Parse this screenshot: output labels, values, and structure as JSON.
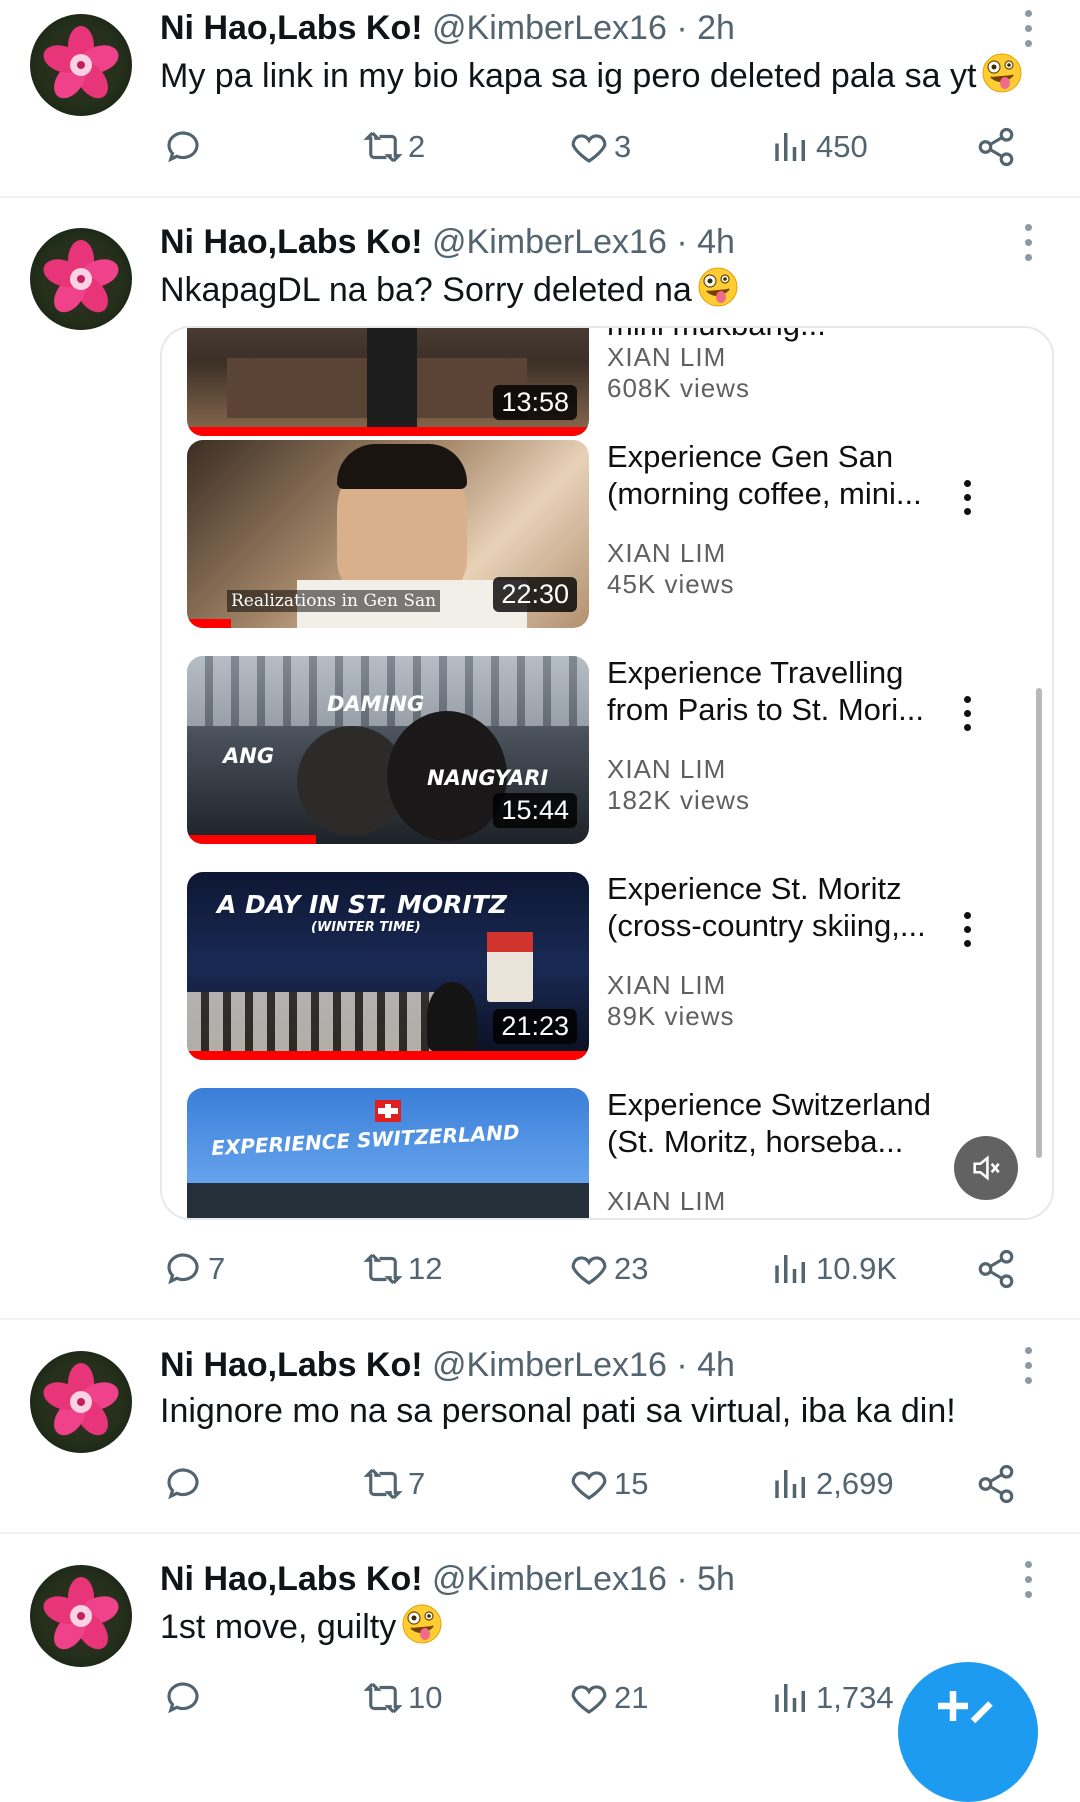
{
  "author": {
    "name": "Ni Hao,Labs Ko!",
    "handle": "@KimberLex16",
    "separator": "·"
  },
  "tweets": [
    {
      "time": "2h",
      "text": "My pa link in my bio kapa sa ig pero deleted pala sa yt",
      "emoji": "zany-face",
      "replies": "",
      "retweets": "2",
      "likes": "3",
      "views": "450"
    },
    {
      "time": "4h",
      "text": "NkapagDL na ba? Sorry deleted na",
      "emoji": "zany-face",
      "replies": "7",
      "retweets": "12",
      "likes": "23",
      "views": "10.9K",
      "media": {
        "videos": [
          {
            "title": "mini mukbang...",
            "channel": "XIAN LIM",
            "views": "608K views",
            "duration": "13:58",
            "progress": 1.0
          },
          {
            "title": "Experience Gen San (morning coffee, mini...",
            "channel": "XIAN LIM",
            "views": "45K views",
            "duration": "22:30",
            "progress": 0.11,
            "caption": "Realizations in Gen San"
          },
          {
            "title": "Experience Travelling from Paris to St. Mori...",
            "channel": "XIAN LIM",
            "views": "182K views",
            "duration": "15:44",
            "progress": 0.32,
            "overlay": [
              "DAMING",
              "ANG",
              "NANGYARI"
            ]
          },
          {
            "title": "Experience St. Moritz (cross-country skiing,...",
            "channel": "XIAN LIM",
            "views": "89K views",
            "duration": "21:23",
            "progress": 1.0,
            "overlay": [
              "A DAY IN ST. MORITZ",
              "(WINTER TIME)"
            ]
          },
          {
            "title": "Experience Switzerland (St. Moritz, horseba...",
            "channel": "XIAN LIM",
            "views": "",
            "duration": "",
            "progress": 0,
            "overlay": [
              "EXPERIENCE SWITZERLAND"
            ]
          }
        ],
        "muted": true
      }
    },
    {
      "time": "4h",
      "text": "Inignore mo na sa personal pati sa virtual, iba ka din!",
      "replies": "",
      "retweets": "7",
      "likes": "15",
      "views": "2,699"
    },
    {
      "time": "5h",
      "text": "1st move, guilty",
      "emoji": "zany-face",
      "replies": "",
      "retweets": "10",
      "likes": "21",
      "views": "1,734"
    }
  ],
  "icons": {
    "reply": "reply-icon",
    "retweet": "retweet-icon",
    "like": "heart-icon",
    "views": "views-icon",
    "share": "share-icon",
    "compose": "compose-plus-icon",
    "mute": "muted-speaker-icon"
  },
  "colors": {
    "accent": "#1d9bf0",
    "secondary_text": "#536471",
    "youtube_progress": "#ff0000"
  }
}
